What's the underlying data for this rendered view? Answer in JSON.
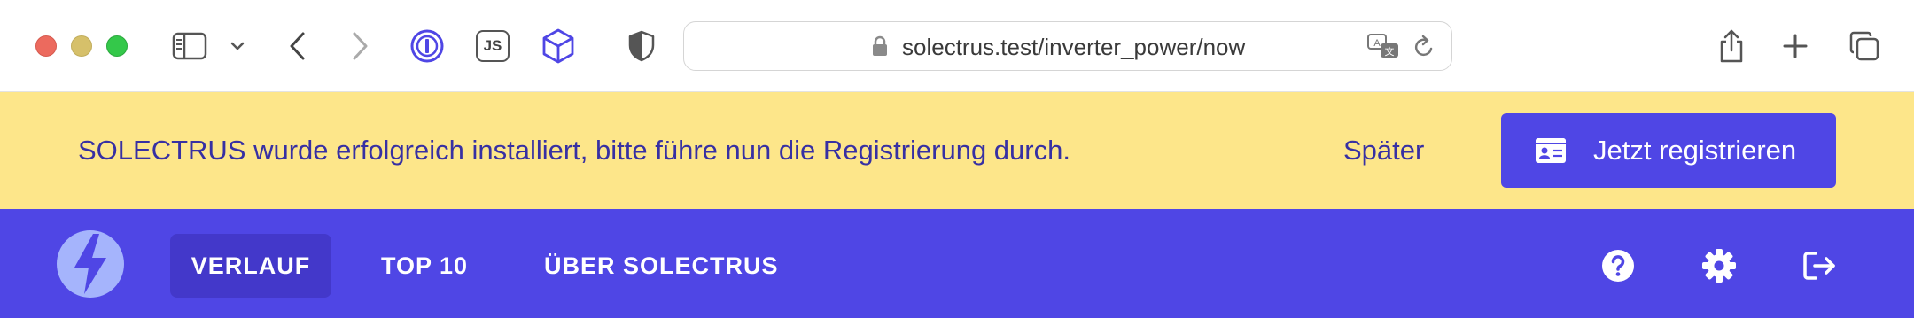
{
  "browser": {
    "url": "solectrus.test/inverter_power/now",
    "extensions": {
      "js_label": "JS"
    }
  },
  "banner": {
    "message": "SOLECTRUS wurde erfolgreich installiert, bitte führe nun die Registrierung durch.",
    "later_label": "Später",
    "register_label": "Jetzt registrieren"
  },
  "nav": {
    "items": [
      {
        "label": "VERLAUF",
        "active": true
      },
      {
        "label": "TOP 10",
        "active": false
      },
      {
        "label": "ÜBER SOLECTRUS",
        "active": false
      }
    ]
  },
  "colors": {
    "banner_bg": "#fde68a",
    "banner_text": "#3730a3",
    "primary": "#4f46e5",
    "nav_active": "#4338ca"
  }
}
